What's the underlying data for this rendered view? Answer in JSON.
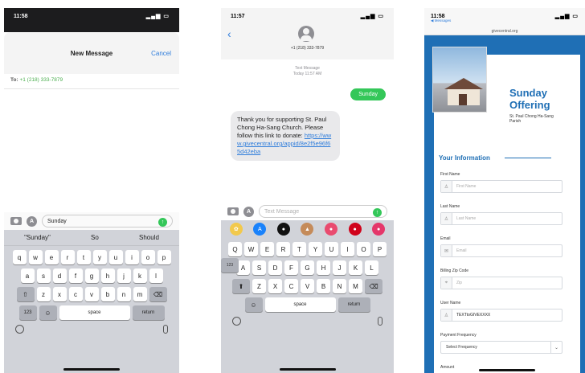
{
  "phone1": {
    "status": {
      "time": "11:58",
      "signal": "..."
    },
    "sheet": {
      "title": "New Message",
      "cancel": "Cancel"
    },
    "to": {
      "label": "To:",
      "recipient": "+1 (218) 333-7879"
    },
    "input": {
      "text": "Sunday"
    },
    "predictions": [
      "\"Sunday\"",
      "So",
      "Should"
    ],
    "keys": {
      "row1": [
        "q",
        "w",
        "e",
        "r",
        "t",
        "y",
        "u",
        "i",
        "o",
        "p"
      ],
      "row2": [
        "a",
        "s",
        "d",
        "f",
        "g",
        "h",
        "j",
        "k",
        "l"
      ],
      "row3": [
        "z",
        "x",
        "c",
        "v",
        "b",
        "n",
        "m"
      ],
      "num": "123",
      "space": "space",
      "return": "return"
    }
  },
  "phone2": {
    "status": {
      "time": "11:57"
    },
    "contact": {
      "number": "+1 (218) 333-7879"
    },
    "meta": {
      "line1": "Text Message",
      "line2": "Today 11:57 AM"
    },
    "outgoing": "Sunday",
    "incoming": {
      "text": "Thank you for supporting St. Paul Chong Ha-Sang Church. Please follow this link to donate:",
      "link": "https://www.givecentral.org/appid/8e2f5e96f65d42eba"
    },
    "input": {
      "placeholder": "Text Message"
    },
    "emoji_bar": [
      "✿",
      "A",
      "●",
      "▲",
      "●",
      "●",
      "●"
    ],
    "keys": {
      "row1": [
        "Q",
        "W",
        "E",
        "R",
        "T",
        "Y",
        "U",
        "I",
        "O",
        "P"
      ],
      "row2": [
        "A",
        "S",
        "D",
        "F",
        "G",
        "H",
        "J",
        "K",
        "L"
      ],
      "row3": [
        "Z",
        "X",
        "C",
        "V",
        "B",
        "N",
        "M"
      ],
      "num": "123",
      "space": "space",
      "return": "return"
    }
  },
  "phone3": {
    "status": {
      "time": "11:58"
    },
    "back": "◀ Messages",
    "url": "givecentral.org",
    "brand": {
      "title": "Sunday Offering",
      "subtitle": "St. Paul Chong Ha-Sang Parish"
    },
    "section": "Your Information",
    "fields": [
      {
        "label": "First Name",
        "placeholder": "First Name",
        "icon": "person-icon"
      },
      {
        "label": "Last Name",
        "placeholder": "Last Name",
        "icon": "person-icon"
      },
      {
        "label": "Email",
        "placeholder": "Email",
        "icon": "mail-icon"
      },
      {
        "label": "Billing Zip Code",
        "placeholder": "Zip",
        "icon": "pin-icon"
      },
      {
        "label": "User Name",
        "value": "TEXTtoGIVEXXXX",
        "icon": "person-icon"
      }
    ],
    "frequency": {
      "label": "Payment Frequency",
      "value": "Select Frequency"
    },
    "amount_label": "Amount"
  },
  "colors": {
    "ios_green": "#34c759",
    "ios_blue": "#2f7ddb",
    "brand_blue": "#1f6fb5"
  }
}
